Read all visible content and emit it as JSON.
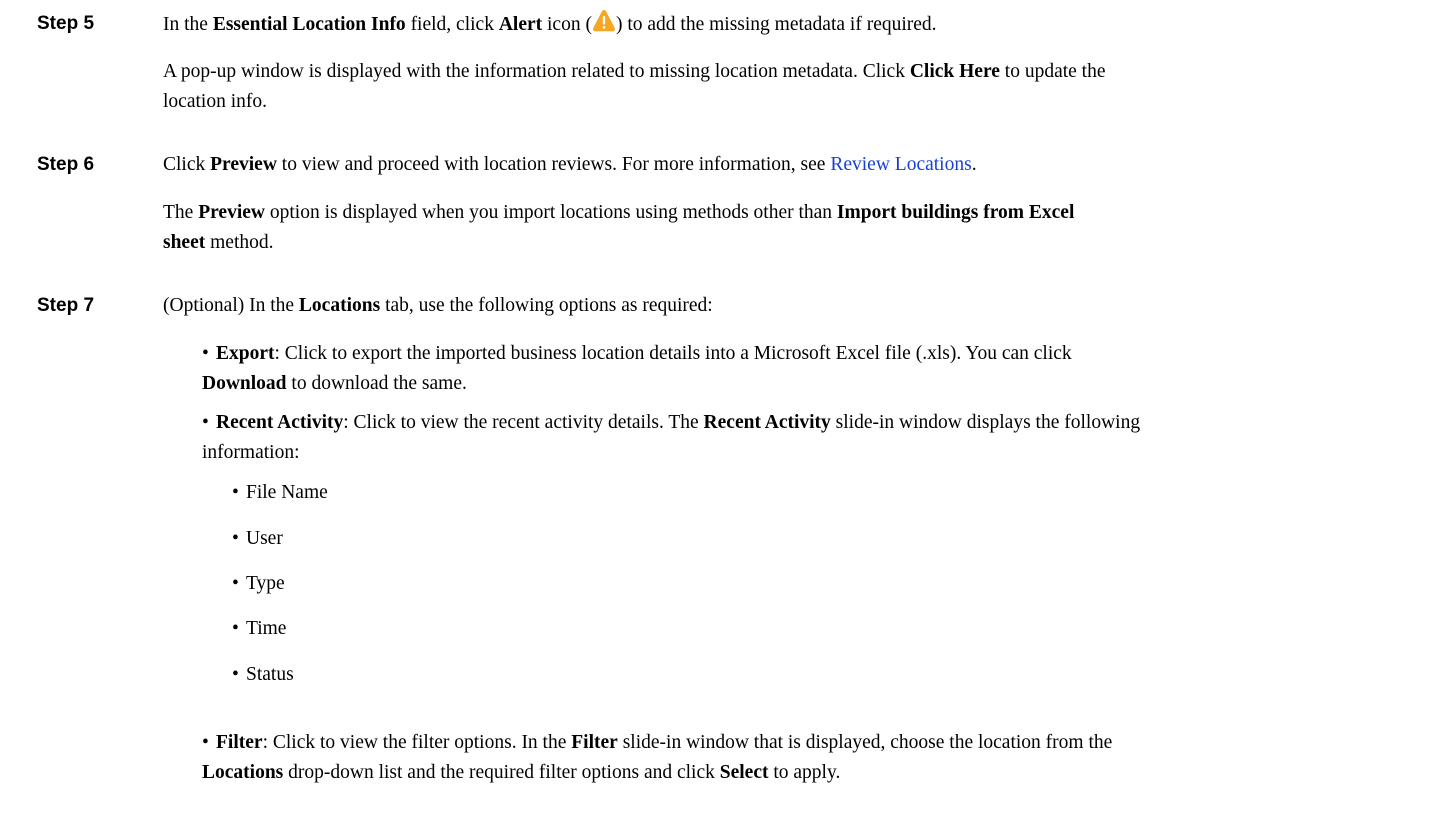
{
  "step5": {
    "label": "Step 5",
    "p1": {
      "t1": "In the ",
      "b1": "Essential Location Info",
      "t2": " field, click ",
      "b2": "Alert",
      "t3": " icon (",
      "t4": ") to add the missing metadata if required."
    },
    "p2": {
      "t1": "A pop-up window is displayed with the information related to missing location metadata. Click ",
      "b1": "Click Here",
      "t2": " to update the",
      "line2": "location info."
    }
  },
  "step6": {
    "label": "Step 6",
    "p1": {
      "t1": "Click ",
      "b1": "Preview",
      "t2": " to view and proceed with location reviews. For more information, see ",
      "link": "Review Locations",
      "t3": "."
    },
    "p2": {
      "t1": "The ",
      "b1": "Preview",
      "t2": " option is displayed when you import locations using methods other than ",
      "b2": "Import buildings from Excel",
      "b3": "sheet",
      "t3": " method."
    }
  },
  "step7": {
    "label": "Step 7",
    "p1": {
      "t1": "(Optional) In the ",
      "b1": "Locations",
      "t2": " tab, use the following options as required:"
    },
    "export": {
      "b1": "Export",
      "t1": ": Click to export the imported business location details into a Microsoft Excel file (.xls). You can click",
      "b2": "Download",
      "t2": " to download the same."
    },
    "recent": {
      "b1": "Recent Activity",
      "t1": ": Click to view the recent activity details. The ",
      "b2": "Recent Activity",
      "t2": " slide-in window displays the following",
      "line2": "information:"
    },
    "recent_items": [
      "File Name",
      "User",
      "Type",
      "Time",
      "Status"
    ],
    "filter": {
      "b1": "Filter",
      "t1": ": Click to view the filter options. In the ",
      "b2": "Filter",
      "t2": " slide-in window that is displayed, choose the location from the",
      "b3": "Locations",
      "t3": " drop-down list and the required filter options and click ",
      "b4": "Select",
      "t4": " to apply."
    }
  },
  "bullet_char": "•",
  "colors": {
    "link": "#1a3fd6",
    "alert_icon": "#f5a623"
  }
}
